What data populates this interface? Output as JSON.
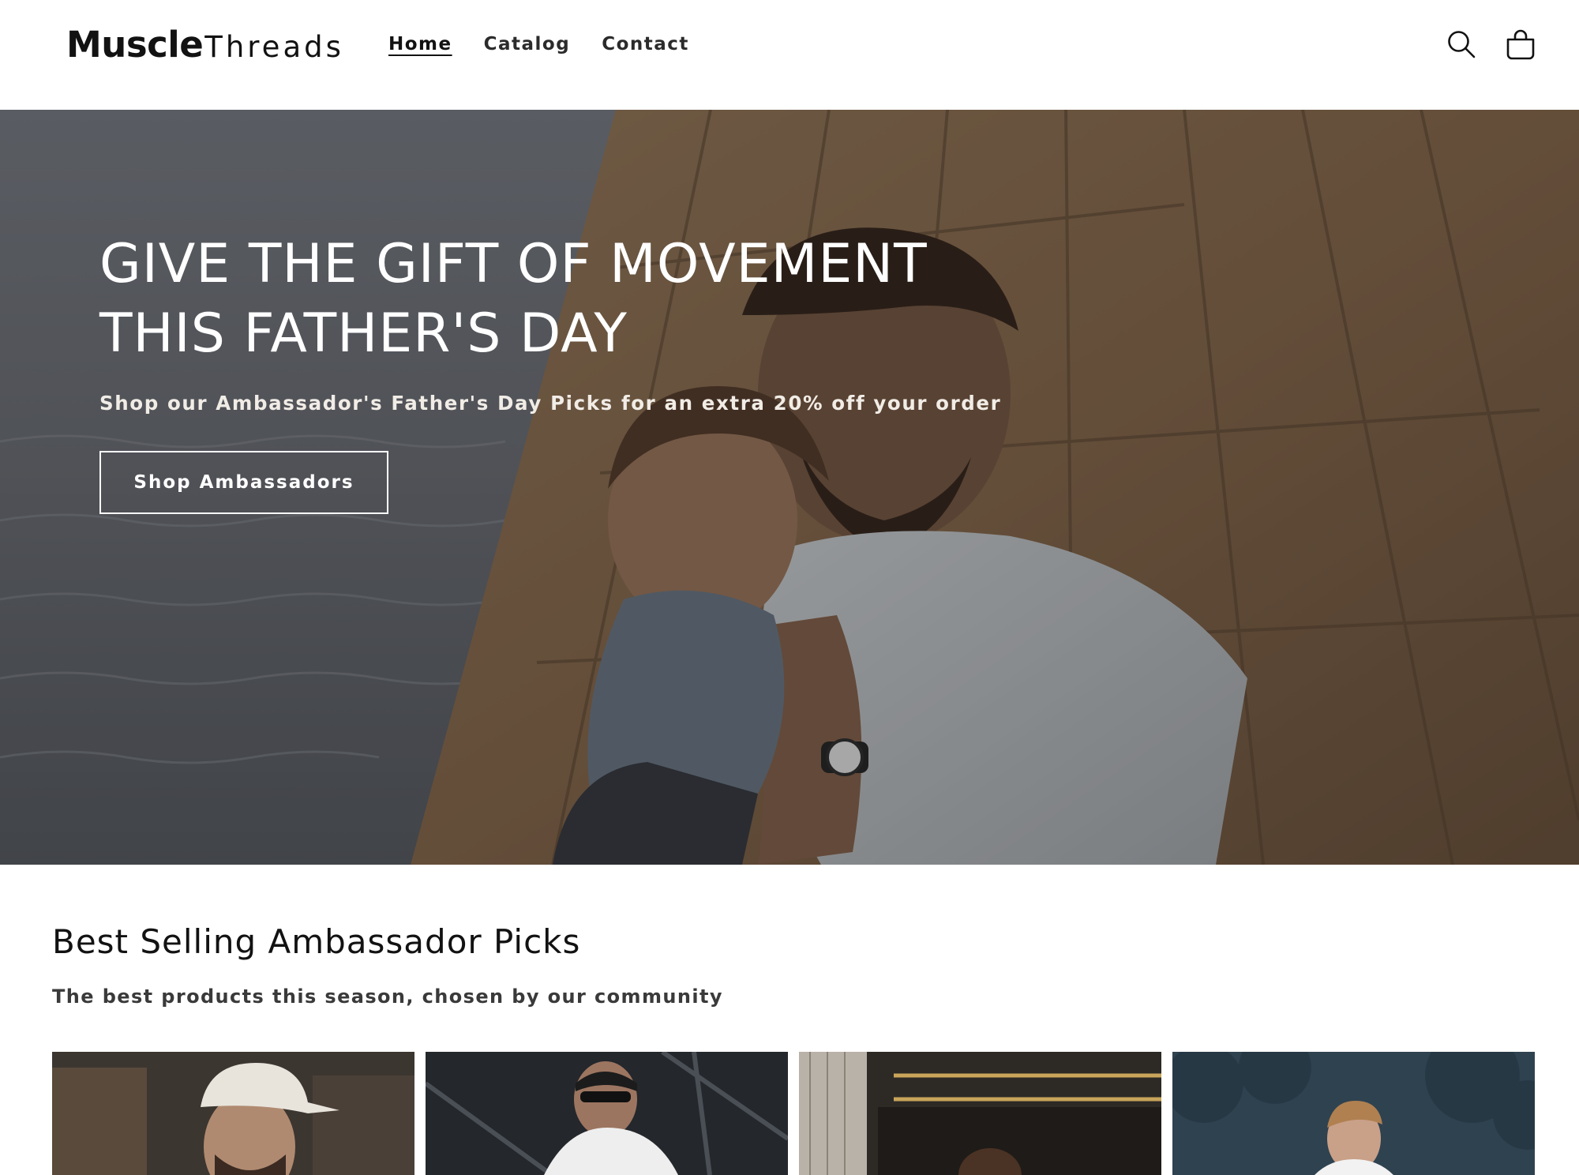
{
  "header": {
    "logo_bold": "Muscle",
    "logo_light": "Threads",
    "nav": [
      {
        "label": "Home",
        "active": true
      },
      {
        "label": "Catalog",
        "active": false
      },
      {
        "label": "Contact",
        "active": false
      }
    ],
    "icons": {
      "search": "search-icon",
      "cart": "cart-icon"
    }
  },
  "hero": {
    "title": "GIVE THE GIFT OF MOVEMENT THIS FATHER'S DAY",
    "subtitle": "Shop our Ambassador's Father's Day Picks for an extra 20% off your order",
    "button_label": "Shop Ambassadors"
  },
  "collection": {
    "title": "Best Selling Ambassador Picks",
    "subtitle": "The best products this season, chosen by our community",
    "products": [
      {
        "image": "man-in-white-cap-photo"
      },
      {
        "image": "man-in-sunglasses-photo"
      },
      {
        "image": "man-in-warehouse-photo"
      },
      {
        "image": "man-by-forest-photo"
      }
    ]
  },
  "colors": {
    "text": "#121212",
    "hero_text": "#ffffff",
    "background": "#ffffff"
  }
}
